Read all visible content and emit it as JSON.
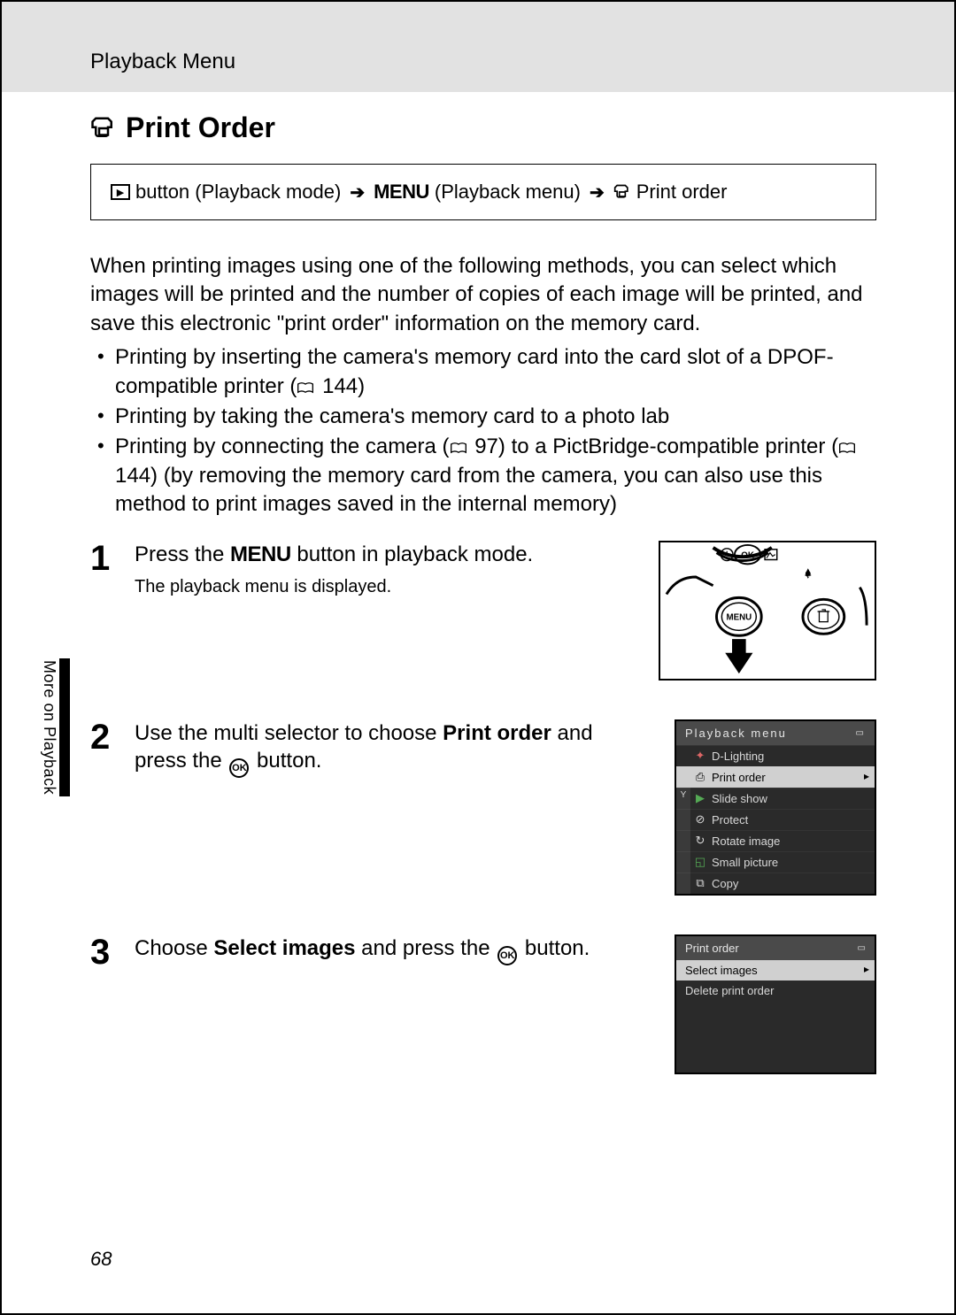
{
  "header": {
    "breadcrumb": "Playback Menu"
  },
  "title": "Print Order",
  "navpath": {
    "playback_button_suffix": "button (Playback mode)",
    "menu_word": "MENU",
    "playback_menu_suffix": "(Playback menu)",
    "print_order": "Print order"
  },
  "intro": "When printing images using one of the following methods, you can select which images will be printed and the number of copies of each image will be printed, and save this electronic \"print order\" information on the memory card.",
  "bullets": {
    "b1a": "Printing by inserting the camera's memory card into the card slot of a DPOF-compatible printer (",
    "b1_ref": "144",
    "b1b": ")",
    "b2": "Printing by taking the camera's memory card to a photo lab",
    "b3a": "Printing by connecting the camera (",
    "b3_ref1": "97",
    "b3b": ") to a PictBridge-compatible printer (",
    "b3_ref2": "144",
    "b3c": ") (by removing the memory card from the camera, you can also use this method to print images saved in the internal memory)"
  },
  "sidetab": "More on Playback",
  "steps": {
    "s1": {
      "num": "1",
      "head_pre": "Press the ",
      "menu_word": "MENU",
      "head_post": " button in playback mode.",
      "sub": "The playback menu is displayed."
    },
    "s2": {
      "num": "2",
      "head_pre": "Use the multi selector to choose ",
      "head_bold": "Print order",
      "head_mid": " and press the ",
      "ok": "OK",
      "head_post": " button."
    },
    "s3": {
      "num": "3",
      "head_pre": "Choose ",
      "head_bold": "Select images",
      "head_mid": " and press the ",
      "ok": "OK",
      "head_post": " button."
    }
  },
  "lcd1": {
    "title": "Playback menu",
    "items": [
      "D-Lighting",
      "Print order",
      "Slide show",
      "Protect",
      "Rotate image",
      "Small picture",
      "Copy"
    ],
    "selected_index": 1
  },
  "lcd2": {
    "title": "Print order",
    "items": [
      "Select images",
      "Delete print order"
    ],
    "selected_index": 0
  },
  "page_number": "68"
}
